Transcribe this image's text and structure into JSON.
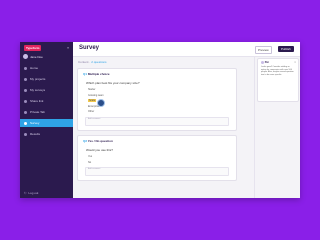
{
  "sidebar": {
    "brand": "Typeform",
    "user": "Jane Doe",
    "items": [
      {
        "label": "Home"
      },
      {
        "label": "My projects"
      },
      {
        "label": "My surveys"
      },
      {
        "label": "Share link"
      },
      {
        "label": "Private Tab"
      },
      {
        "label": "Survey",
        "active": true
      },
      {
        "label": "Results"
      }
    ],
    "bottom": "Log out"
  },
  "header": {
    "title": "Survey",
    "preview_label": "Preview",
    "publish_label": "Publish"
  },
  "editor": {
    "breadcrumb_prefix": "Content",
    "breadcrumb_accent": "2 questions",
    "q1": {
      "number": "Q1",
      "label": "Multiple choice",
      "text": "Which plan best fits your company size?",
      "options": [
        "Starter",
        "Growing team",
        "Scale",
        "Enterprise",
        "Other"
      ],
      "selected_index": 2,
      "comment_placeholder": "Add comment"
    },
    "q2": {
      "number": "Q2",
      "label": "Yes / No question",
      "text": "Would you use this?",
      "options": [
        "Yes",
        "No"
      ],
      "comment_placeholder": "Add comment"
    }
  },
  "panel": {
    "name": "Pat",
    "close": "×",
    "body": "Looks good! Consider adding an option for companies with over 500 people. Also, maybe reword question two to be more specific."
  }
}
